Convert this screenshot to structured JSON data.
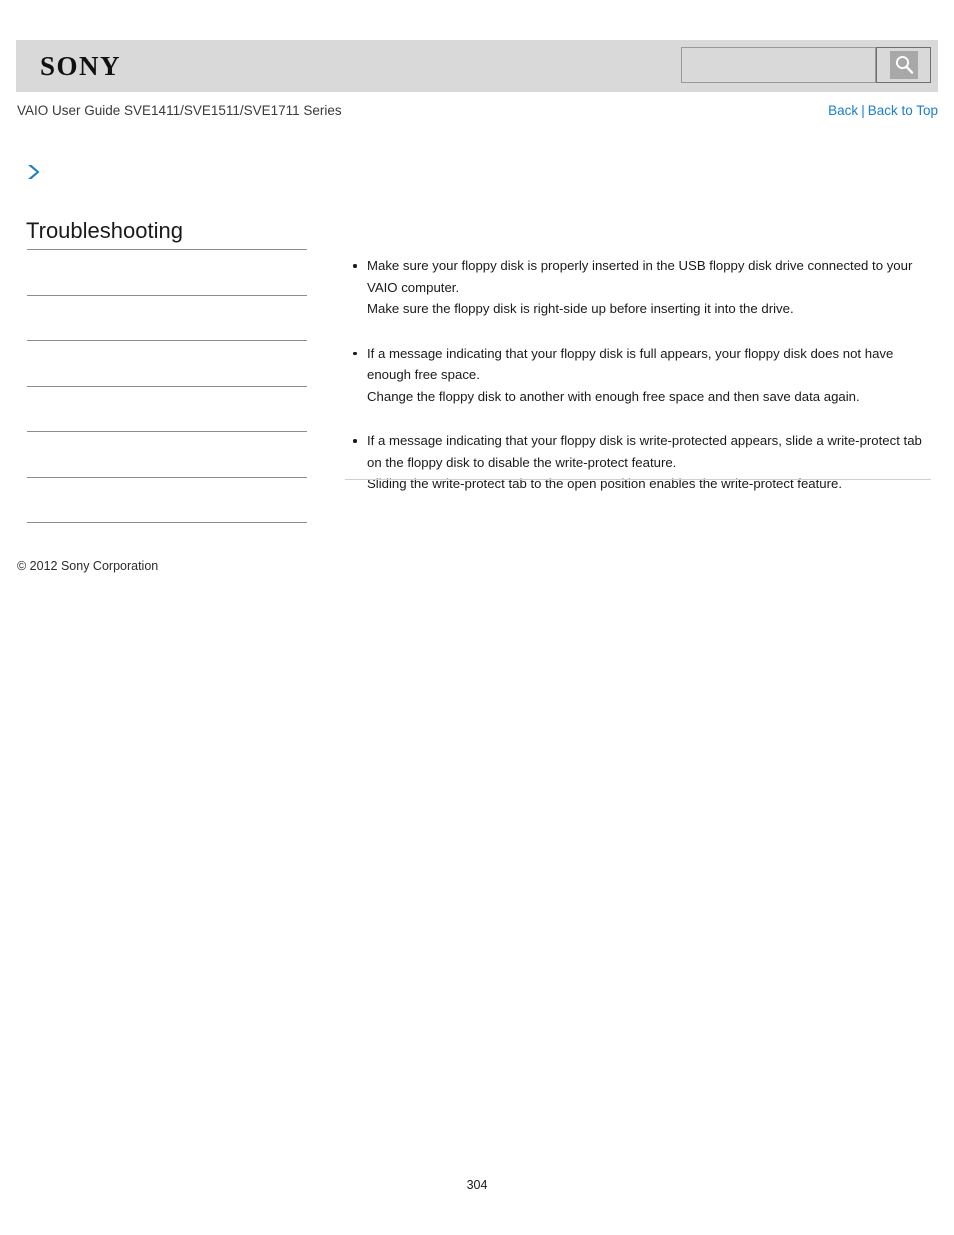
{
  "header": {
    "logo_text": "SONY",
    "logo_icon": "sony-wordmark",
    "search": {
      "value": "",
      "placeholder": "",
      "button_icon": "search-magnifier-icon",
      "button_label": ""
    }
  },
  "titlebar": {
    "guide_title": "VAIO User Guide SVE1411/SVE1511/SVE1711 Series",
    "back_label": "Back",
    "separator": "|",
    "back_to_top_label": "Back to Top",
    "link_color": "#1a7ec8"
  },
  "sidebar": {
    "breadcrumb_icon": "chevron-right-icon",
    "breadcrumb_color": "#1b7fc4",
    "heading": "Troubleshooting",
    "items": [
      {
        "label": ""
      },
      {
        "label": ""
      },
      {
        "label": ""
      },
      {
        "label": ""
      },
      {
        "label": ""
      },
      {
        "label": ""
      },
      {
        "label": ""
      }
    ]
  },
  "content": {
    "tips": [
      {
        "lines": [
          "Make sure your floppy disk is properly inserted in the USB floppy disk drive connected to your VAIO computer.",
          "Make sure the floppy disk is right-side up before inserting it into the drive."
        ]
      },
      {
        "lines": [
          "If a message indicating that your floppy disk is full appears, your floppy disk does not have enough free space.",
          "Change the floppy disk to another with enough free space and then save data again."
        ]
      },
      {
        "lines": [
          "If a message indicating that your floppy disk is write-protected appears, slide a write-protect tab on the floppy disk to disable the write-protect feature.",
          "Sliding the write-protect tab to the open position enables the write-protect feature."
        ]
      }
    ]
  },
  "footer": {
    "copyright": "© 2012 Sony Corporation",
    "page_number": "304"
  }
}
